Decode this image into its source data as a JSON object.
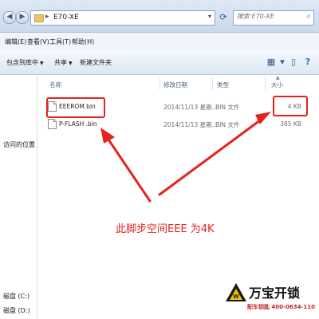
{
  "address": {
    "path": "E70-XE",
    "search_placeholder": "搜索 E70-XE"
  },
  "menu": [
    "编辑(E)",
    "查看(V)",
    "工具(T)",
    "帮助(H)"
  ],
  "toolbar": {
    "include_library": "包含到库中",
    "share": "共享",
    "new_folder": "新建文件夹"
  },
  "nav": {
    "items": [
      "访问的位置",
      "磁盘 (C:)",
      "磁盘 (D:)"
    ]
  },
  "columns": {
    "name": "名称",
    "date": "修改日期",
    "type": "类型",
    "size": "大小"
  },
  "files": [
    {
      "name": "EEEROM.bin",
      "date": "2014/11/13 星期...",
      "type": "BIN 文件",
      "size": "4 KB"
    },
    {
      "name": "P-FLASH .bin",
      "date": "2014/11/13 星期...",
      "type": "BIN 文件",
      "size": "385 KB"
    }
  ],
  "annotation": {
    "caption": "此脚步空间EEE 为4K",
    "color": "#e4231f"
  },
  "watermark": {
    "brand": "万宝开锁",
    "subline": "配车钥匙 400-0634-110"
  },
  "icons": {
    "back": "back-arrow-icon",
    "forward": "forward-arrow-icon",
    "refresh": "refresh-icon",
    "search": "search-icon",
    "folder": "folder-icon",
    "file": "file-icon"
  }
}
